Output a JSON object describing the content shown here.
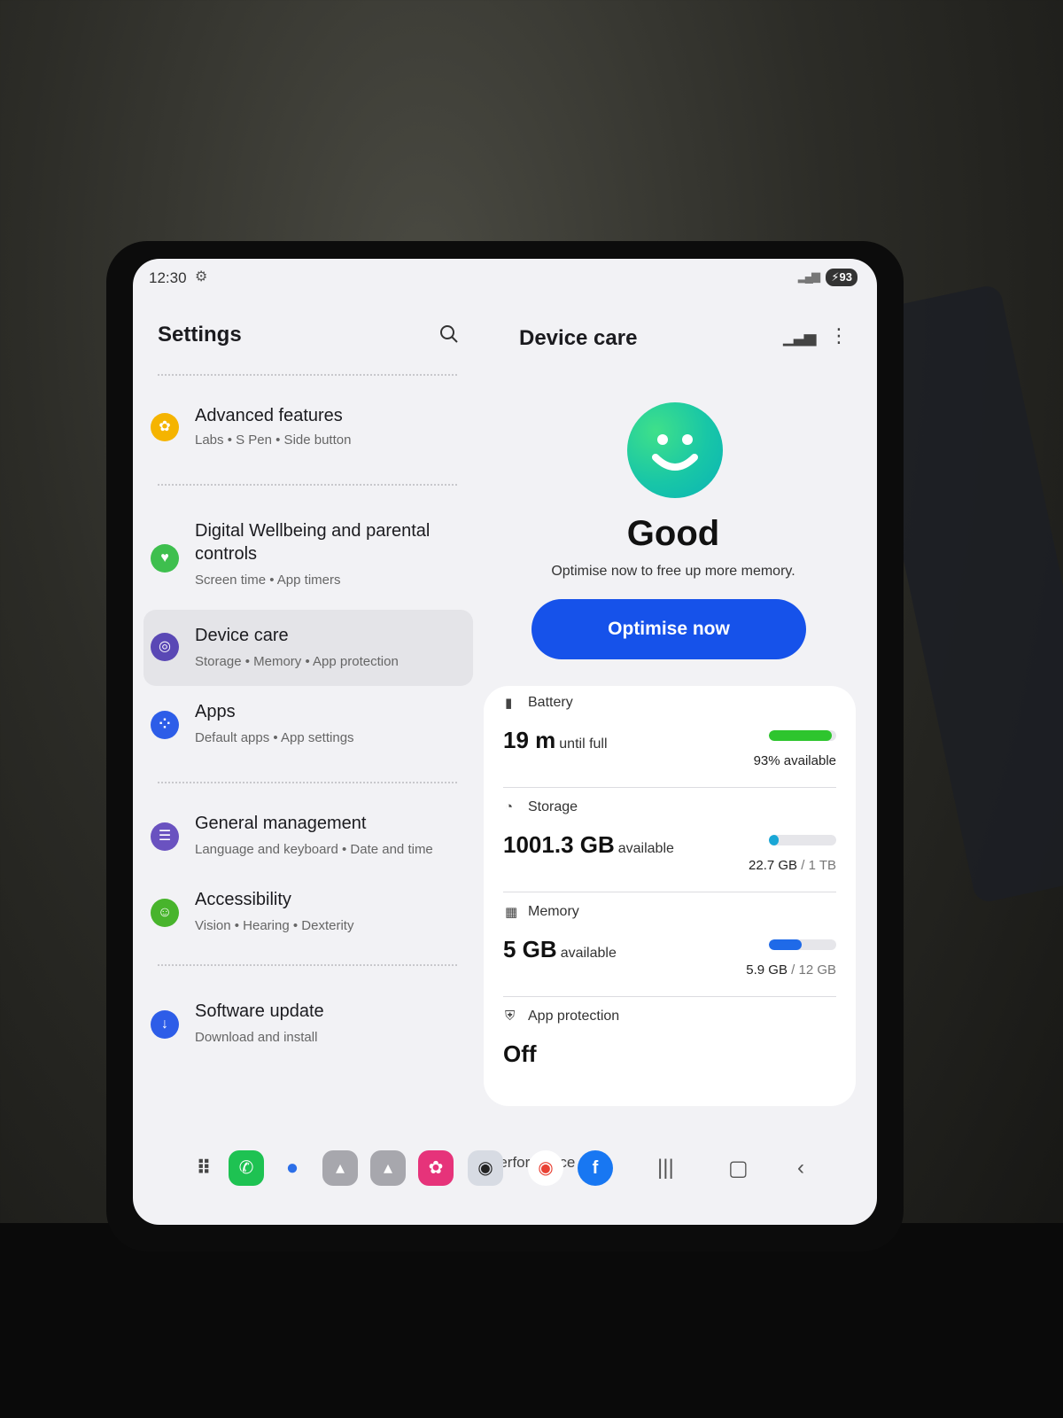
{
  "status_bar": {
    "time": "12:30",
    "battery": "93"
  },
  "left_pane": {
    "title": "Settings",
    "items": [
      {
        "title": "Advanced features",
        "subtitle": "Labs  •  S Pen  •  Side button",
        "color": "#f5b400"
      },
      {
        "title": "Digital Wellbeing and parental controls",
        "subtitle": "Screen time  •  App timers",
        "color": "#3ebf4e"
      },
      {
        "title": "Device care",
        "subtitle": "Storage  •  Memory  •  App protection",
        "color": "#5a48b5"
      },
      {
        "title": "Apps",
        "subtitle": "Default apps  •  App settings",
        "color": "#2d5de8"
      },
      {
        "title": "General management",
        "subtitle": "Language and keyboard  •  Date and time",
        "color": "#6a52c0"
      },
      {
        "title": "Accessibility",
        "subtitle": "Vision  •  Hearing  •  Dexterity",
        "color": "#48b42c"
      },
      {
        "title": "Software update",
        "subtitle": "Download and install",
        "color": "#2d5de8"
      }
    ]
  },
  "right_pane": {
    "title": "Device care",
    "status": "Good",
    "description": "Optimise now to free up more memory.",
    "optimise_label": "Optimise now",
    "battery": {
      "label": "Battery",
      "value": "19 m",
      "unit": "until full",
      "detail": "93% available",
      "level": 0.93,
      "color": "#2ec52e"
    },
    "storage": {
      "label": "Storage",
      "value": "1001.3 GB",
      "unit": "available",
      "used": "22.7 GB",
      "total": "/ 1 TB",
      "level": 0.023,
      "color": "#1aa7d6"
    },
    "memory": {
      "label": "Memory",
      "value": "5 GB",
      "unit": "available",
      "used": "5.9 GB",
      "total": "/ 12 GB",
      "level": 0.49,
      "color": "#1f6ae8"
    },
    "app_protection": {
      "label": "App protection",
      "value": "Off"
    },
    "performance_label": "Performance"
  },
  "dock": {
    "icons": [
      "apps-grid-icon",
      "phone-icon",
      "messages-icon",
      "android-app-icon",
      "android-app-icon",
      "gallery-icon",
      "camera-icon",
      "chrome-icon",
      "facebook-icon"
    ],
    "nav": [
      "recents-icon",
      "home-icon",
      "back-icon"
    ]
  }
}
